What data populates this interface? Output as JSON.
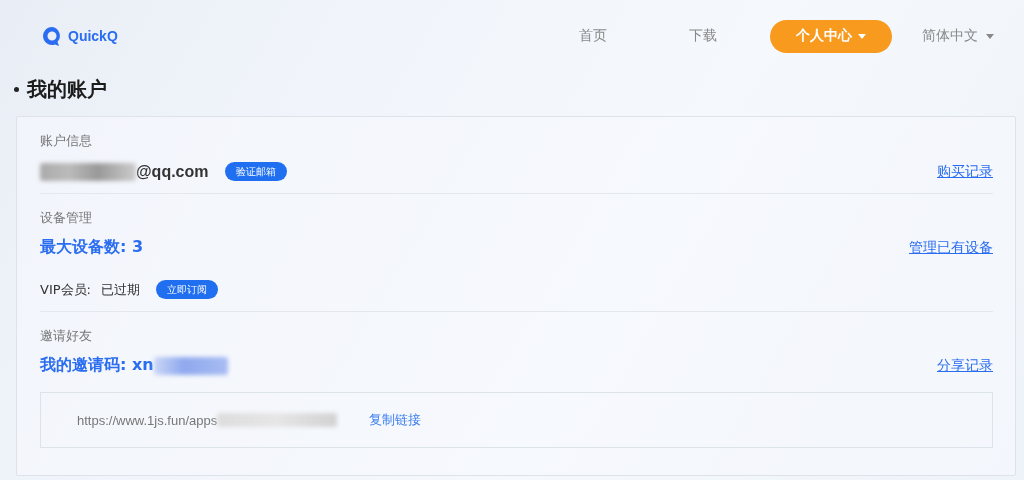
{
  "logo": {
    "text": "QuickQ"
  },
  "nav": {
    "items": [
      {
        "label": "首页",
        "selected": false,
        "dropdown": false
      },
      {
        "label": "下载",
        "selected": false,
        "dropdown": false
      },
      {
        "label": "个人中心",
        "selected": true,
        "dropdown": true
      }
    ],
    "language": "简体中文"
  },
  "page_title": "我的账户",
  "sections": [
    {
      "kind": "account",
      "heading": "账户信息",
      "email_redacted": true,
      "email": "@qq.com",
      "badge": "验证邮箱",
      "link": "购买记录"
    },
    {
      "kind": "devices",
      "heading": "设备管理",
      "headline": "最大设备数: 3",
      "link": "管理已有设备",
      "vip_label": "VIP会员:",
      "vip_status": "已过期",
      "badge": "立即订阅"
    },
    {
      "kind": "invite",
      "heading": "邀请好友",
      "headline": "我的邀请码: xn",
      "code_redacted": true,
      "link": "分享记录",
      "url": "https://www.1js.fun/apps",
      "url_redacted": true,
      "copy": "复制链接"
    }
  ]
}
